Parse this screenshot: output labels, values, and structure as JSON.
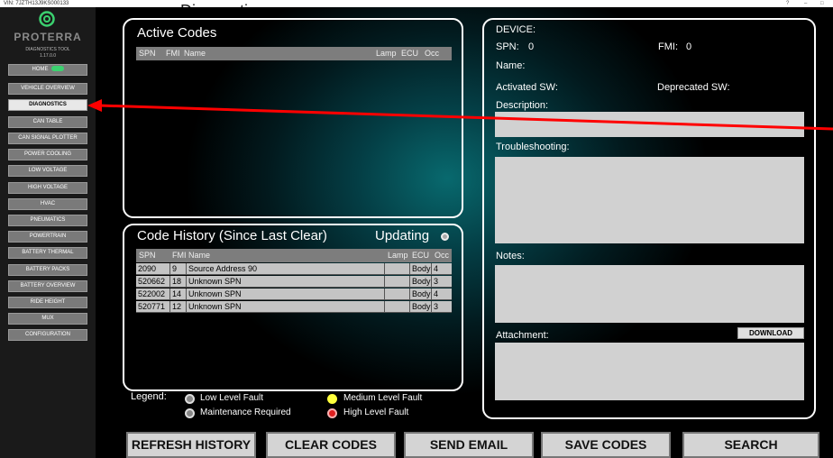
{
  "titlebar": {
    "vin": "VIN: 7JZTH13J9KS000133",
    "help": "?",
    "minimize": "–",
    "restore": "□"
  },
  "top_heading_clip": "Diagnostics",
  "logo": {
    "brand": "PROTERRA",
    "product": "DIAGNOSTICS TOOL",
    "version": "1.17.0.0"
  },
  "nav": [
    {
      "label": "HOME",
      "badge": "ON"
    },
    {
      "label": "VEHICLE OVERVIEW"
    },
    {
      "label": "DIAGNOSTICS",
      "active": true
    },
    {
      "label": "CAN TABLE"
    },
    {
      "label": "CAN SIGNAL PLOTTER"
    },
    {
      "label": "POWER COOLING"
    },
    {
      "label": "LOW VOLTAGE"
    },
    {
      "label": "HIGH VOLTAGE"
    },
    {
      "label": "HVAC"
    },
    {
      "label": "PNEUMATICS"
    },
    {
      "label": "POWERTRAIN"
    },
    {
      "label": "BATTERY THERMAL"
    },
    {
      "label": "BATTERY PACKS"
    },
    {
      "label": "BATTERY OVERVIEW"
    },
    {
      "label": "RIDE HEIGHT"
    },
    {
      "label": "MUX"
    },
    {
      "label": "CONFIGURATION"
    }
  ],
  "active_codes": {
    "title": "Active Codes",
    "columns": {
      "spn": "SPN",
      "fmi": "FMI",
      "name": "Name",
      "lamp": "Lamp",
      "ecu": "ECU",
      "occ": "Occ"
    }
  },
  "code_history": {
    "title": "Code History (Since Last Clear)",
    "status": "Updating",
    "columns": {
      "spn": "SPN",
      "fmi": "FMI",
      "name": "Name",
      "lamp": "Lamp",
      "ecu": "ECU",
      "occ": "Occ"
    },
    "rows": [
      {
        "spn": "2090",
        "fmi": "9",
        "name": "Source Address 90",
        "lamp": "",
        "ecu": "Body",
        "occ": "4"
      },
      {
        "spn": "520662",
        "fmi": "18",
        "name": "Unknown SPN",
        "lamp": "",
        "ecu": "Body",
        "occ": "3"
      },
      {
        "spn": "522002",
        "fmi": "14",
        "name": "Unknown SPN",
        "lamp": "",
        "ecu": "Body",
        "occ": "4"
      },
      {
        "spn": "520771",
        "fmi": "12",
        "name": "Unknown SPN",
        "lamp": "",
        "ecu": "Body",
        "occ": "3"
      }
    ]
  },
  "legend": {
    "title": "Legend:",
    "low": "Low Level Fault",
    "maint": "Maintenance Required",
    "medium": "Medium Level Fault",
    "high": "High Level Fault",
    "colors": {
      "low": "#888888",
      "maint": "#888888",
      "medium": "#ffff3c",
      "high": "#e02020"
    }
  },
  "device": {
    "device_label": "DEVICE:",
    "spn_label": "SPN:",
    "spn_value": "0",
    "fmi_label": "FMI:",
    "fmi_value": "0",
    "name_label": "Name:",
    "activated_label": "Activated SW:",
    "deprecated_label": "Deprecated SW:",
    "description_label": "Description:",
    "troubleshooting_label": "Troubleshooting:",
    "notes_label": "Notes:",
    "attachment_label": "Attachment:",
    "download_label": "DOWNLOAD"
  },
  "buttons": {
    "refresh": "REFRESH HISTORY",
    "clear": "CLEAR CODES",
    "email": "SEND EMAIL",
    "save": "SAVE CODES",
    "search": "SEARCH"
  },
  "annotation": {
    "arrow_color": "#ff0000"
  }
}
